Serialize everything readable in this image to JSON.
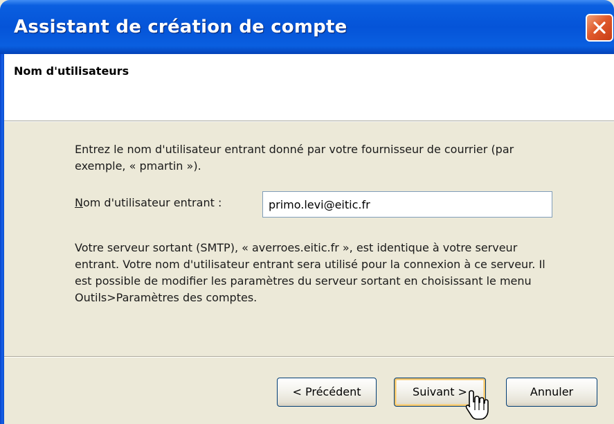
{
  "window": {
    "title": "Assistant de création de compte",
    "close_icon": "close-icon"
  },
  "header": {
    "title": "Nom d'utilisateurs"
  },
  "main": {
    "intro": "Entrez le nom d'utilisateur entrant donné par votre fournisseur de courrier (par exemple, « pmartin »).",
    "field_label_accel": "N",
    "field_label_rest": "om d'utilisateur entrant :",
    "username_value": "primo.levi@eitic.fr",
    "info": "Votre serveur sortant (SMTP), « averroes.eitic.fr », est identique à votre serveur entrant. Votre nom d'utilisateur entrant sera utilisé pour la connexion à ce serveur. Il est possible de modifier les paramètres du serveur sortant en choisissant le menu Outils>Paramètres des comptes."
  },
  "footer": {
    "prev_label": "< Précédent",
    "next_label": "Suivant >",
    "cancel_label": "Annuler"
  },
  "colors": {
    "titlebar": "#0554d8",
    "dialog_bg": "#ece9d8",
    "close_button": "#e05a2c",
    "default_button_focus": "#f2c56a"
  }
}
